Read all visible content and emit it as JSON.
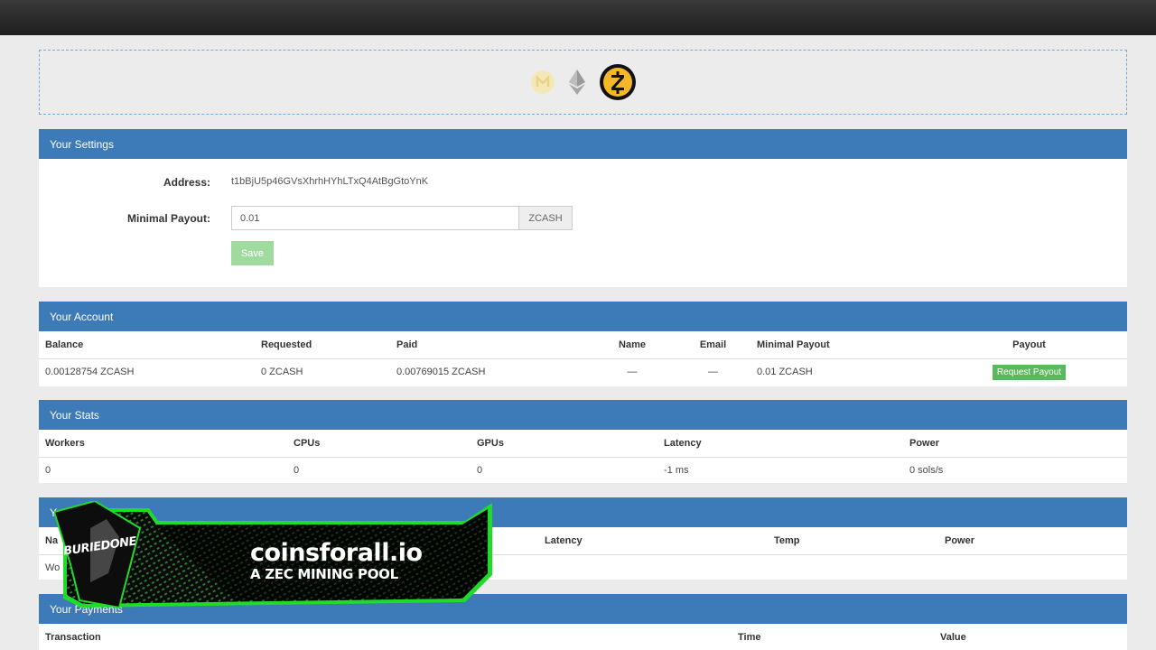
{
  "coins": [
    {
      "icon": "monero-coin-icon",
      "color": "#f3e3a9"
    },
    {
      "icon": "ethereum-coin-icon",
      "color": "#8a8a8a"
    },
    {
      "icon": "zcash-coin-icon",
      "color": "#f4b728"
    }
  ],
  "settings": {
    "title": "Your Settings",
    "address_label": "Address:",
    "address_value": "t1bBjU5p46GVsXhrhHYhLTxQ4AtBgGtoYnK",
    "payout_label": "Minimal Payout:",
    "payout_value": "0.01",
    "payout_unit": "ZCASH",
    "save_label": "Save"
  },
  "account": {
    "title": "Your Account",
    "headers": [
      "Balance",
      "Requested",
      "Paid",
      "Name",
      "Email",
      "Minimal Payout",
      "Payout"
    ],
    "row": {
      "balance": "0.00128754 ZCASH",
      "requested": "0 ZCASH",
      "paid": "0.00769015 ZCASH",
      "name": "—",
      "email": "—",
      "minimal_payout": "0.01 ZCASH",
      "payout_button": "Request Payout"
    }
  },
  "stats": {
    "title": "Your Stats",
    "headers": [
      "Workers",
      "CPUs",
      "GPUs",
      "Latency",
      "Power"
    ],
    "row": [
      "0",
      "0",
      "0",
      "-1 ms",
      "0 sols/s"
    ]
  },
  "workers": {
    "title_visible": "Your Workers",
    "headers_visible": [
      "Na",
      "Latency",
      "Temp",
      "Power"
    ],
    "row_partial": "Wo"
  },
  "payments": {
    "title": "Your Payments",
    "headers": [
      "Transaction",
      "Time",
      "Value"
    ]
  },
  "overlay": {
    "brand": "BURIEDONE",
    "site": "coinsforall.io",
    "tagline": "A ZEC MINING POOL",
    "accent_color": "#1fdc2a"
  }
}
